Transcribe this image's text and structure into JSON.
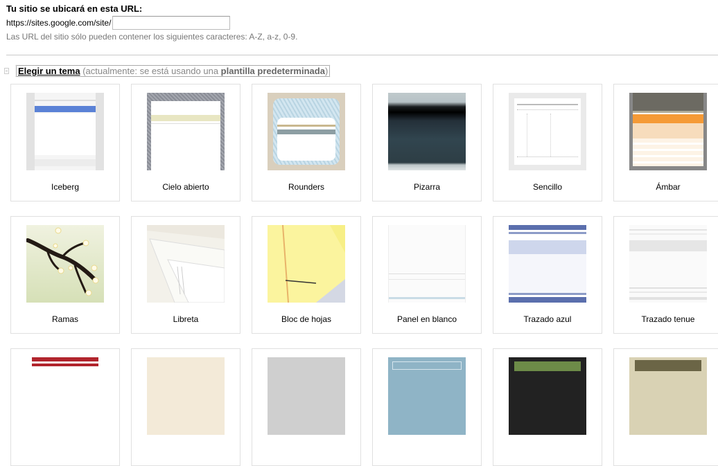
{
  "url_section": {
    "title": "Tu sitio se ubicará en esta URL:",
    "prefix": "https://sites.google.com/site/",
    "input_value": "",
    "hint": "Las URL del sitio sólo pueden contener los siguientes caracteres: A-Z, a-z, 0-9."
  },
  "theme_section": {
    "heading": "Elegir un tema",
    "note_prefix": "(actualmente: se está usando una ",
    "note_strong": "plantilla predeterminada",
    "note_suffix": ")"
  },
  "themes": [
    {
      "label": "Iceberg"
    },
    {
      "label": "Cielo abierto"
    },
    {
      "label": "Rounders"
    },
    {
      "label": "Pizarra"
    },
    {
      "label": "Sencillo"
    },
    {
      "label": "Ámbar"
    },
    {
      "label": "Ramas"
    },
    {
      "label": "Libreta"
    },
    {
      "label": "Bloc de hojas"
    },
    {
      "label": "Panel en blanco"
    },
    {
      "label": "Trazado azul"
    },
    {
      "label": "Trazado tenue"
    }
  ],
  "colors": {
    "iceberg_accent": "#5b82d6",
    "ambar_accent": "#f59a36",
    "azul_accent": "#5b6fad",
    "row3_red": "#b1242c"
  }
}
